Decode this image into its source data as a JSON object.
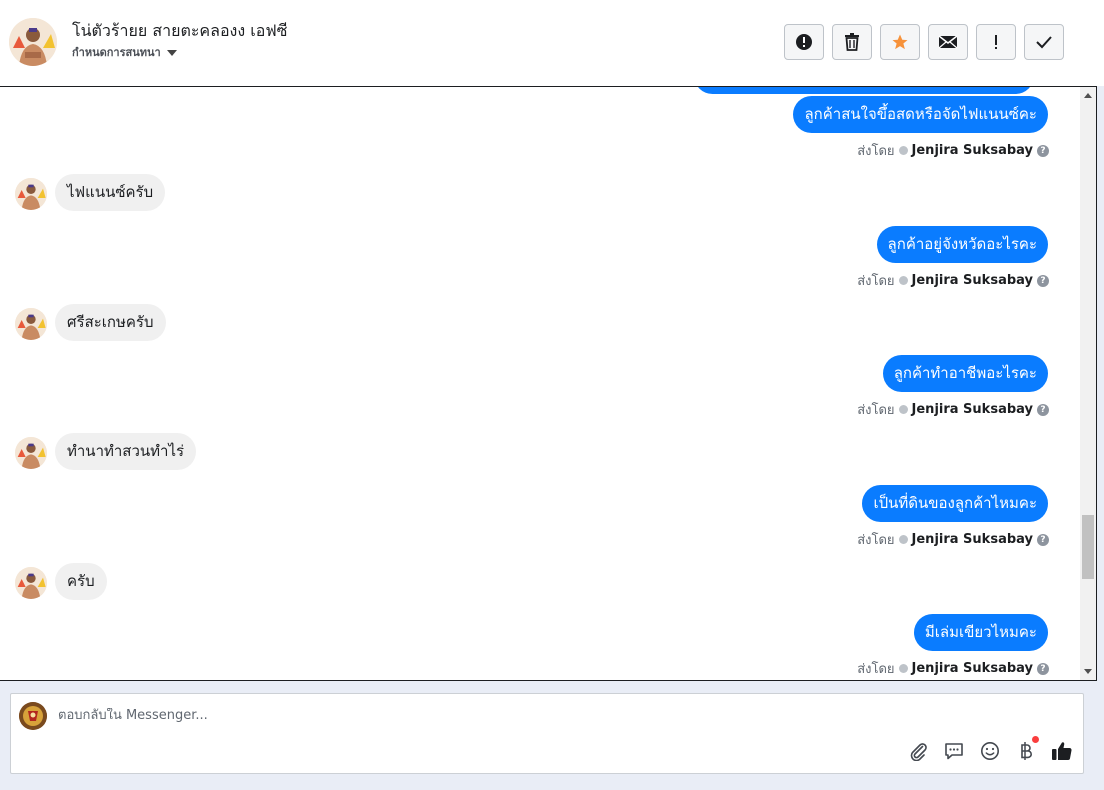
{
  "header": {
    "title": "โน่ตัวร้ายย สายตะคลองง เอฟซี",
    "subtitle": "กำหนดการสนทนา"
  },
  "toolbar": {
    "buttons": [
      {
        "name": "report-spam-button",
        "icon": "exclamation-circle-icon"
      },
      {
        "name": "delete-button",
        "icon": "trash-icon"
      },
      {
        "name": "star-button",
        "icon": "star-icon",
        "color": "#f7923a"
      },
      {
        "name": "mark-unread-button",
        "icon": "envelope-icon"
      },
      {
        "name": "follow-up-button",
        "icon": "exclamation-icon"
      },
      {
        "name": "mark-done-button",
        "icon": "check-icon"
      }
    ]
  },
  "messages": [
    {
      "dir": "out",
      "text": "ลูกค้าสนใจขึ้อสดหรือจัดไฟแนนซ์คะ",
      "sent_by_label": "ส่งโดย",
      "sender": "Jenjira Suksabay"
    },
    {
      "dir": "in",
      "text": "ไฟแนนซ์ครับ"
    },
    {
      "dir": "out",
      "text": "ลูกค้าอยู่จังหวัดอะไรคะ",
      "sent_by_label": "ส่งโดย",
      "sender": "Jenjira Suksabay"
    },
    {
      "dir": "in",
      "text": "ศรีสะเกษครับ"
    },
    {
      "dir": "out",
      "text": "ลูกค้าทำอาชีพอะไรคะ",
      "sent_by_label": "ส่งโดย",
      "sender": "Jenjira Suksabay"
    },
    {
      "dir": "in",
      "text": "ทำนาทำสวนทำไร่"
    },
    {
      "dir": "out",
      "text": "เป็นที่ดินของลูกค้าไหมคะ",
      "sent_by_label": "ส่งโดย",
      "sender": "Jenjira Suksabay"
    },
    {
      "dir": "in",
      "text": "ครับ"
    },
    {
      "dir": "out",
      "text": "มีเล่มเขียวไหมคะ",
      "sent_by_label": "ส่งโดย",
      "sender": "Jenjira Suksabay"
    }
  ],
  "composer": {
    "placeholder": "ตอบกลับใน Messenger..."
  },
  "colors": {
    "accent": "#0a7cff",
    "incoming_bubble": "#f0f0f0"
  }
}
